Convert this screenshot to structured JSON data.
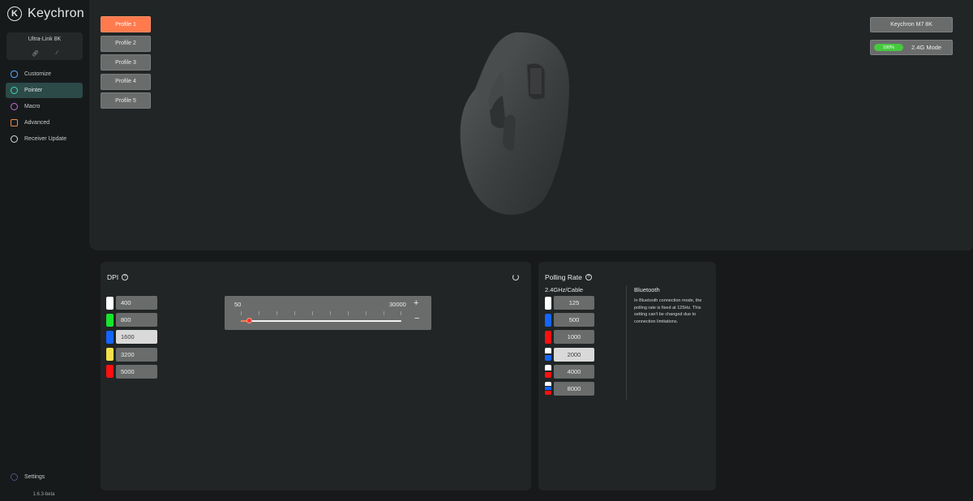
{
  "app": {
    "logo_glyph": "K",
    "logo_text": "Keychron"
  },
  "sidebar": {
    "device": {
      "name": "Ultra-Link 8K",
      "icons": [
        "link-icon",
        "unlink-icon"
      ]
    },
    "items": [
      {
        "label": "Customize",
        "icon": "mouse-icon"
      },
      {
        "label": "Pointer",
        "icon": "pointer-gauge-icon"
      },
      {
        "label": "Macro",
        "icon": "macro-icon"
      },
      {
        "label": "Advanced",
        "icon": "advanced-icon"
      },
      {
        "label": "Receiver Update",
        "icon": "receiver-update-icon"
      }
    ],
    "active_index": 1,
    "settings_label": "Settings",
    "version": "1.6.3-beta"
  },
  "profiles": {
    "items": [
      "Profile 1",
      "Profile 2",
      "Profile 3",
      "Profile 4",
      "Profile 5"
    ],
    "active_index": 0,
    "active_color": "#ff7a4d"
  },
  "status": {
    "model": "Keychron M7 8K",
    "battery": "100%",
    "battery_color": "#46c93f",
    "mode": "2.4G Mode"
  },
  "dpi": {
    "title": "DPI",
    "help_glyph": "?",
    "levels": [
      {
        "value": "400",
        "color": "#ffffff"
      },
      {
        "value": "800",
        "color": "#17e62b"
      },
      {
        "value": "1600",
        "color": "#1565ff"
      },
      {
        "value": "3200",
        "color": "#f6e04a"
      },
      {
        "value": "5000",
        "color": "#ff1010"
      }
    ],
    "selected_index": 2,
    "slider": {
      "min": "50",
      "max": "30000",
      "plus": "+",
      "minus": "−"
    }
  },
  "polling": {
    "title": "Polling Rate",
    "help_glyph": "?",
    "wired_title": "2.4GHz/Cable",
    "rates": [
      {
        "value": "125",
        "colors": [
          "#ffffff"
        ]
      },
      {
        "value": "500",
        "colors": [
          "#1565ff"
        ]
      },
      {
        "value": "1000",
        "colors": [
          "#ff1010"
        ]
      },
      {
        "value": "2000",
        "colors": [
          "#ffffff",
          "#1565ff"
        ]
      },
      {
        "value": "4000",
        "colors": [
          "#ffffff",
          "#ff1010"
        ]
      },
      {
        "value": "8000",
        "colors": [
          "#ffffff",
          "#1565ff",
          "#ff1010"
        ]
      }
    ],
    "selected_index": 3,
    "bluetooth_title": "Bluetooth",
    "bluetooth_note": "In Bluetooth connection mode, the polling rate is fixed at 125Hz. This setting can't be changed due to connection limitations."
  }
}
